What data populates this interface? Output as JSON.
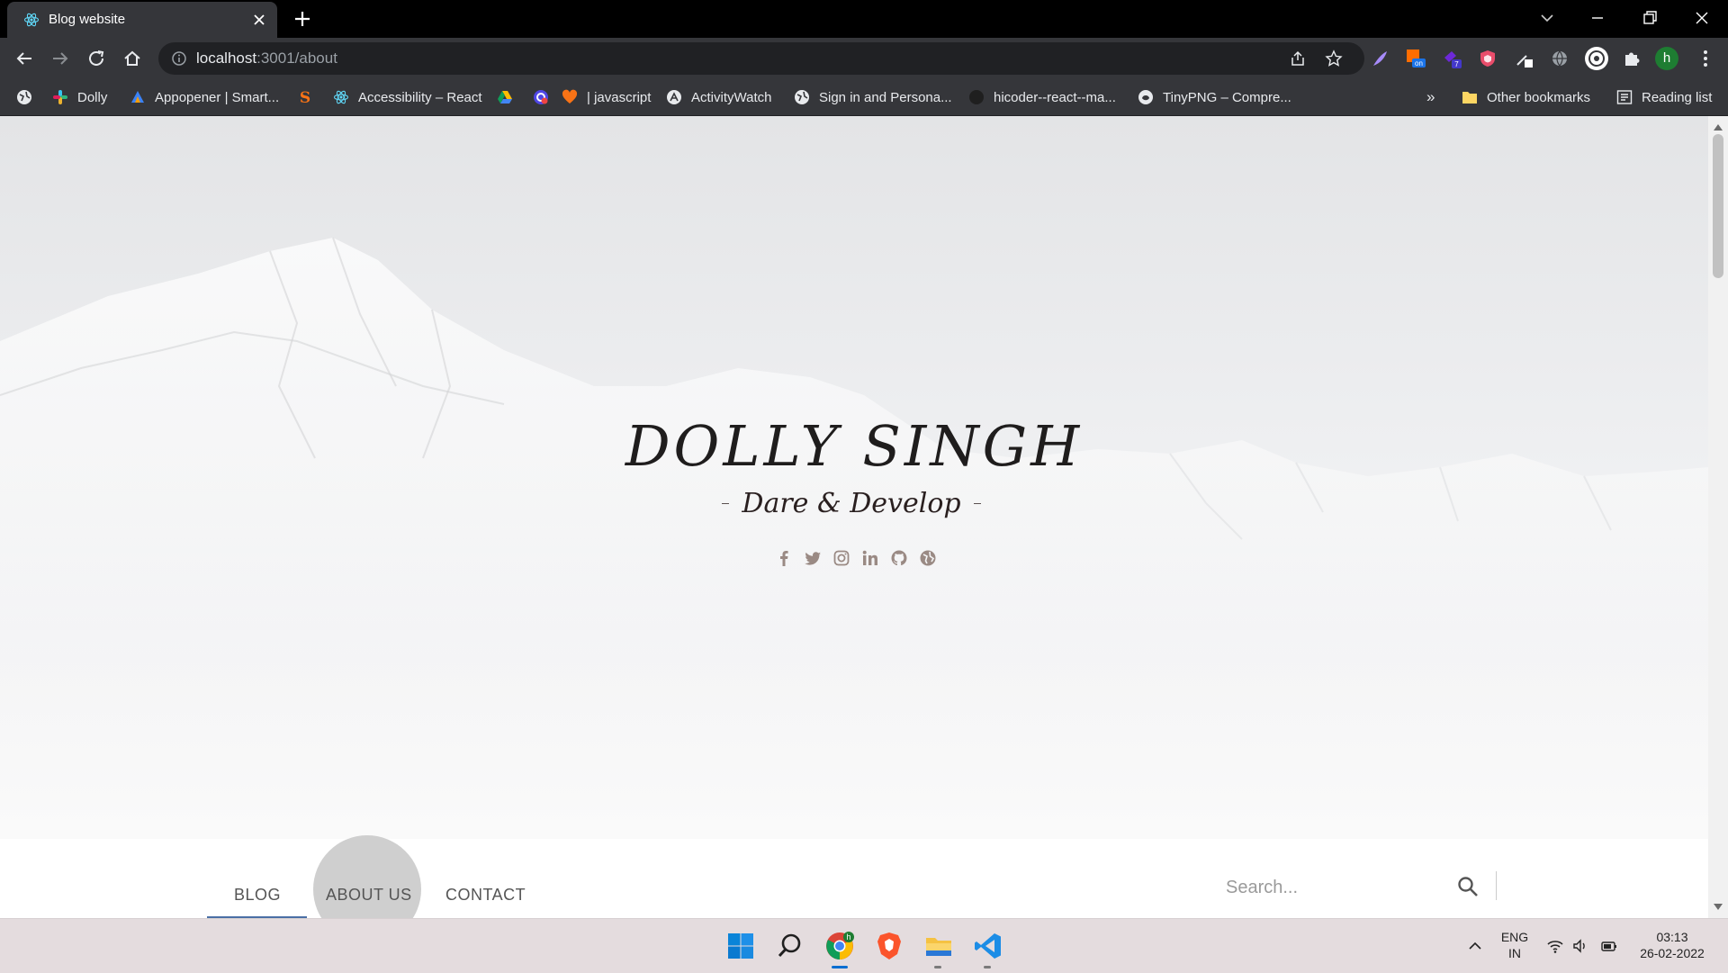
{
  "browser": {
    "tab": {
      "title": "Blog website",
      "favicon": "react-icon"
    },
    "url": {
      "host": "localhost",
      "path": ":3001/about"
    },
    "bookmarks": [
      {
        "label": "",
        "icon": "globe-icon"
      },
      {
        "label": "Dolly",
        "icon": "slack-icon"
      },
      {
        "label": "Appopener | Smart...",
        "icon": "appopener-icon"
      },
      {
        "label": "",
        "icon": "s-logo-icon"
      },
      {
        "label": "Accessibility – React",
        "icon": "react-icon"
      },
      {
        "label": "",
        "icon": "google-drive-icon"
      },
      {
        "label": "",
        "icon": "grammarly-icon"
      },
      {
        "label": "| javascript",
        "icon": "heart-icon"
      },
      {
        "label": "ActivityWatch",
        "icon": "activitywatch-icon"
      },
      {
        "label": "Sign in and Persona...",
        "icon": "globe-icon"
      },
      {
        "label": "hicoder--react--ma...",
        "icon": "github-icon"
      },
      {
        "label": "TinyPNG – Compre...",
        "icon": "tinypng-icon"
      }
    ],
    "more_bookmarks": "»",
    "other_bookmarks": "Other bookmarks",
    "reading_list": "Reading list",
    "profile_initial": "h"
  },
  "hero": {
    "name": "DOLLY SINGH",
    "tagline": "Dare & Develop",
    "socials": [
      "facebook-icon",
      "twitter-icon",
      "instagram-icon",
      "linkedin-icon",
      "github-icon",
      "globe-icon"
    ]
  },
  "nav": {
    "items": [
      {
        "label": "BLOG",
        "active": true
      },
      {
        "label": "ABOUT US",
        "active": false
      },
      {
        "label": "CONTACT",
        "active": false
      }
    ],
    "search_placeholder": "Search..."
  },
  "taskbar": {
    "language": "ENG",
    "region": "IN",
    "time": "03:13",
    "date": "26-02-2022"
  }
}
